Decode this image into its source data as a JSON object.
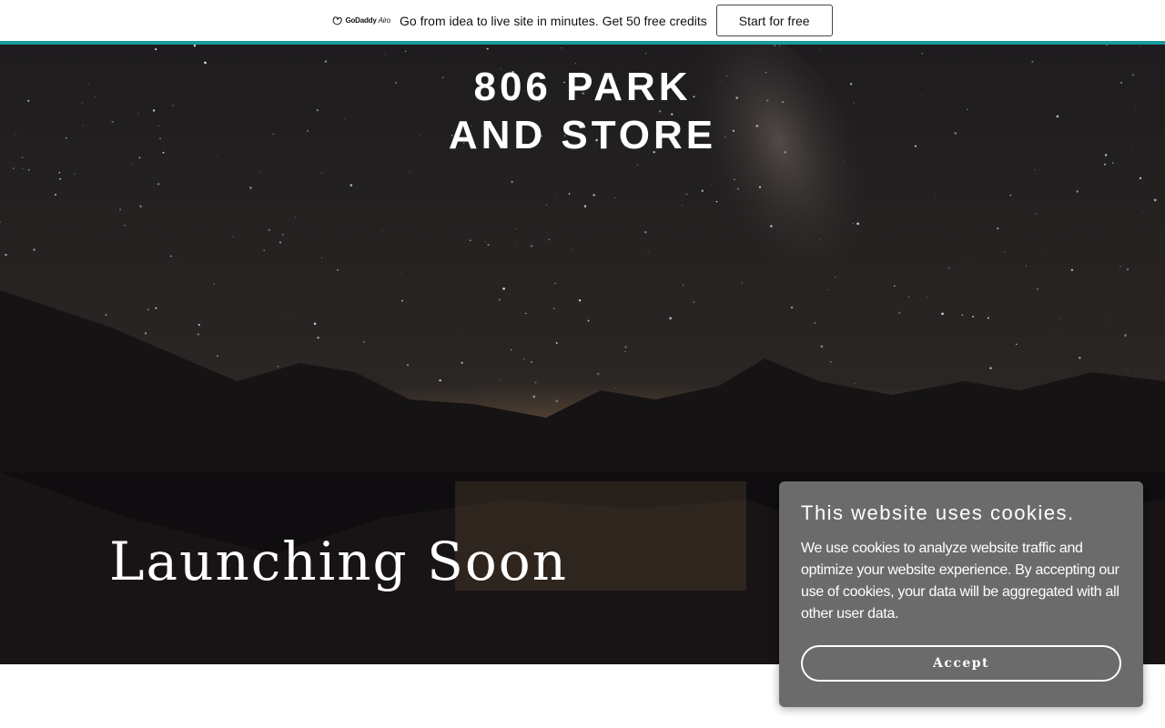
{
  "promo": {
    "brand_name": "GoDaddy",
    "brand_suffix": "Airo",
    "message": "Go from idea to live site in minutes. Get 50 free credits",
    "cta_label": "Start for free",
    "accent_color": "#1b9c9c"
  },
  "hero": {
    "title_line1": "806 PARK",
    "title_line2": "AND STORE",
    "tagline": "Launching Soon",
    "background_description_icon": "night-sky-mountain-lake-image"
  },
  "cookie_banner": {
    "title": "This website uses cookies.",
    "body": "We use cookies to analyze website traffic and optimize your website experience. By accepting our use of cookies, your data will be aggregated with all other user data.",
    "accept_label": "Accept",
    "background_color": "#6b6b6b"
  }
}
